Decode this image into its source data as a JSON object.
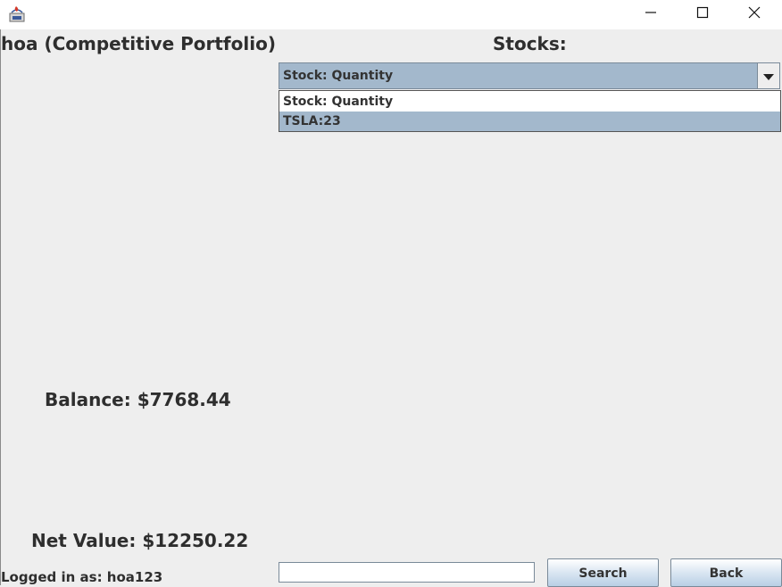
{
  "titlebar": {
    "app_icon": "java-cup-icon",
    "controls": [
      "minimize-icon",
      "maximize-icon",
      "close-icon"
    ]
  },
  "portfolio": {
    "title": "hoa (Competitive Portfolio)",
    "balance": "Balance: $7768.44",
    "net_value": "Net Value: $12250.22",
    "logged_in": "Logged in as: hoa123"
  },
  "stocks": {
    "label": "Stocks:",
    "selected": "Stock: Quantity",
    "options": [
      "Stock: Quantity",
      "TSLA:23"
    ],
    "highlighted_option": "TSLA:23"
  },
  "search": {
    "value": "",
    "placeholder": "",
    "button_label": "Search"
  },
  "back_button_label": "Back",
  "colors": {
    "background": "#eeeeee",
    "selection": "#a3b8cc",
    "text": "#2e2e2e"
  }
}
